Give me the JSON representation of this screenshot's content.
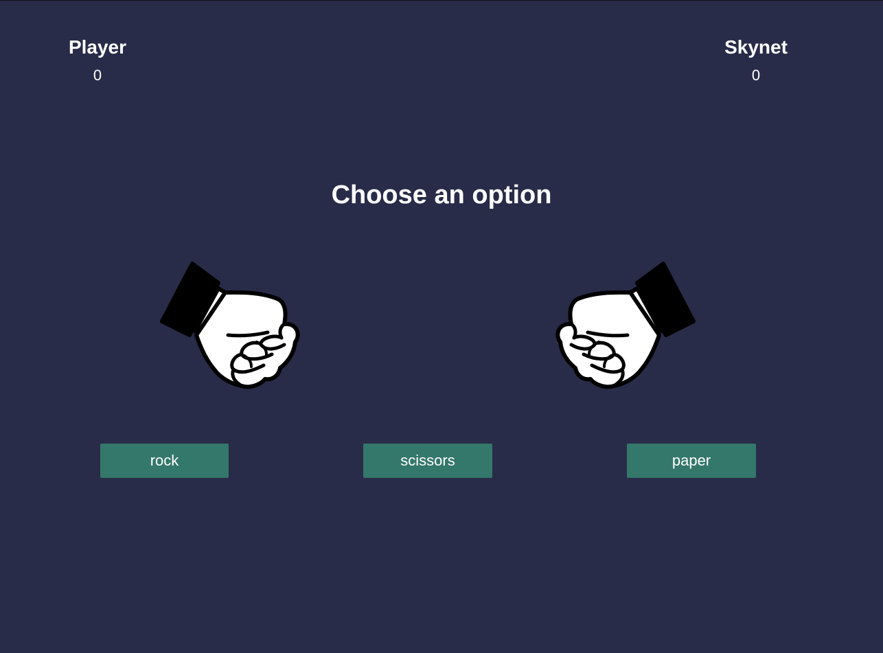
{
  "scoreboard": {
    "player": {
      "name": "Player",
      "score": "0"
    },
    "cpu": {
      "name": "Skynet",
      "score": "0"
    }
  },
  "prompt": "Choose an option",
  "hands": {
    "player": {
      "icon": "rock-fist-icon"
    },
    "cpu": {
      "icon": "rock-fist-icon"
    }
  },
  "choices": [
    {
      "label": "rock"
    },
    {
      "label": "scissors"
    },
    {
      "label": "paper"
    }
  ],
  "colors": {
    "background": "#292c48",
    "button": "#34776b",
    "text": "#ffffff"
  }
}
